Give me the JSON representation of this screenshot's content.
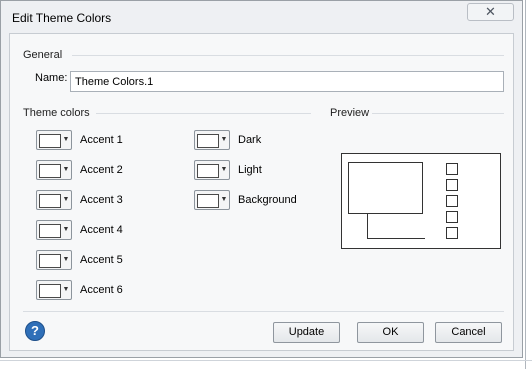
{
  "window": {
    "title": "Edit Theme Colors",
    "close_glyph": "✕"
  },
  "general": {
    "label": "General",
    "name_label": "Name:",
    "name_value": "Theme Colors.1"
  },
  "theme_colors": {
    "label": "Theme colors",
    "left": [
      "Accent 1",
      "Accent 2",
      "Accent 3",
      "Accent 4",
      "Accent 5",
      "Accent 6"
    ],
    "right": [
      "Dark",
      "Light",
      "Background"
    ]
  },
  "preview": {
    "label": "Preview"
  },
  "footer": {
    "help_glyph": "?",
    "update": "Update",
    "ok": "OK",
    "cancel": "Cancel"
  },
  "icons": {
    "dropdown": "chevron-down-icon",
    "help": "help-icon",
    "close": "close-icon"
  },
  "colors": {
    "swatch_fill": "#ffffff",
    "help_blue": "#2f6fb8"
  }
}
